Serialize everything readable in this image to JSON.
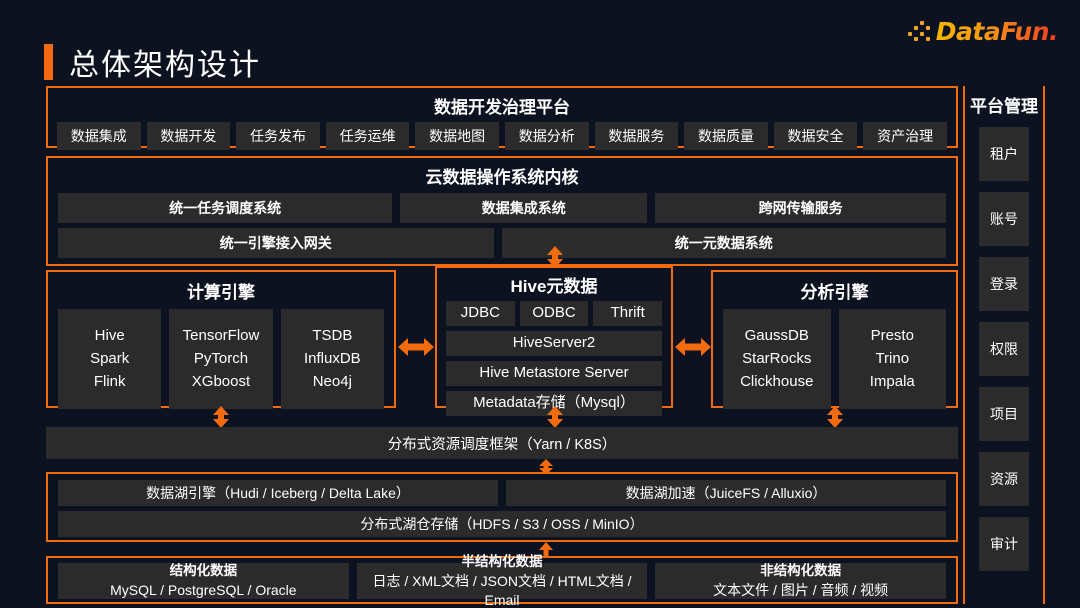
{
  "logo": {
    "text": "DataFun.",
    "accent": "#f7a41d"
  },
  "page": {
    "title": "总体架构设计",
    "accent": "#f26b0f",
    "background": "#0d1220",
    "cell_bg": "#2b2b2b"
  },
  "layers": {
    "govern": {
      "title": "数据开发治理平台",
      "items": [
        "数据集成",
        "数据开发",
        "任务发布",
        "任务运维",
        "数据地图",
        "数据分析",
        "数据服务",
        "数据质量",
        "数据安全",
        "资产治理"
      ]
    },
    "kernel": {
      "title": "云数据操作系统内核",
      "row1": [
        "统一任务调度系统",
        "数据集成系统",
        "跨网传输服务"
      ],
      "row2": [
        "统一引擎接入网关",
        "统一元数据系统"
      ]
    },
    "compute": {
      "title": "计算引擎",
      "columns": [
        [
          "Hive",
          "Spark",
          "Flink"
        ],
        [
          "TensorFlow",
          "PyTorch",
          "XGboost"
        ],
        [
          "TSDB",
          "InfluxDB",
          "Neo4j"
        ]
      ]
    },
    "hive_meta": {
      "title": "Hive元数据",
      "protocols": [
        "JDBC",
        "ODBC",
        "Thrift"
      ],
      "rows": [
        "HiveServer2",
        "Hive Metastore Server",
        "Metadata存储（Mysql）"
      ]
    },
    "analytics": {
      "title": "分析引擎",
      "columns": [
        [
          "GaussDB",
          "StarRocks",
          "Clickhouse"
        ],
        [
          "Presto",
          "Trino",
          "Impala"
        ]
      ]
    },
    "scheduler": {
      "label": "分布式资源调度框架（Yarn / K8S）"
    },
    "lake": {
      "row1": [
        "数据湖引擎（Hudi / Iceberg / Delta Lake）",
        "数据湖加速（JuiceFS / Alluxio）"
      ],
      "row2": "分布式湖仓存储（HDFS / S3 / OSS / MinIO）"
    },
    "sources": [
      {
        "title": "结构化数据",
        "detail": "MySQL / PostgreSQL / Oracle"
      },
      {
        "title": "半结构化数据",
        "detail": "日志 / XML文档 / JSON文档 / HTML文档 /  Email"
      },
      {
        "title": "非结构化数据",
        "detail": "文本文件 / 图片 / 音频 / 视频"
      }
    ]
  },
  "sidebar": {
    "title": "平台管理",
    "items": [
      "租户",
      "账号",
      "登录",
      "权限",
      "项目",
      "资源",
      "审计"
    ]
  }
}
